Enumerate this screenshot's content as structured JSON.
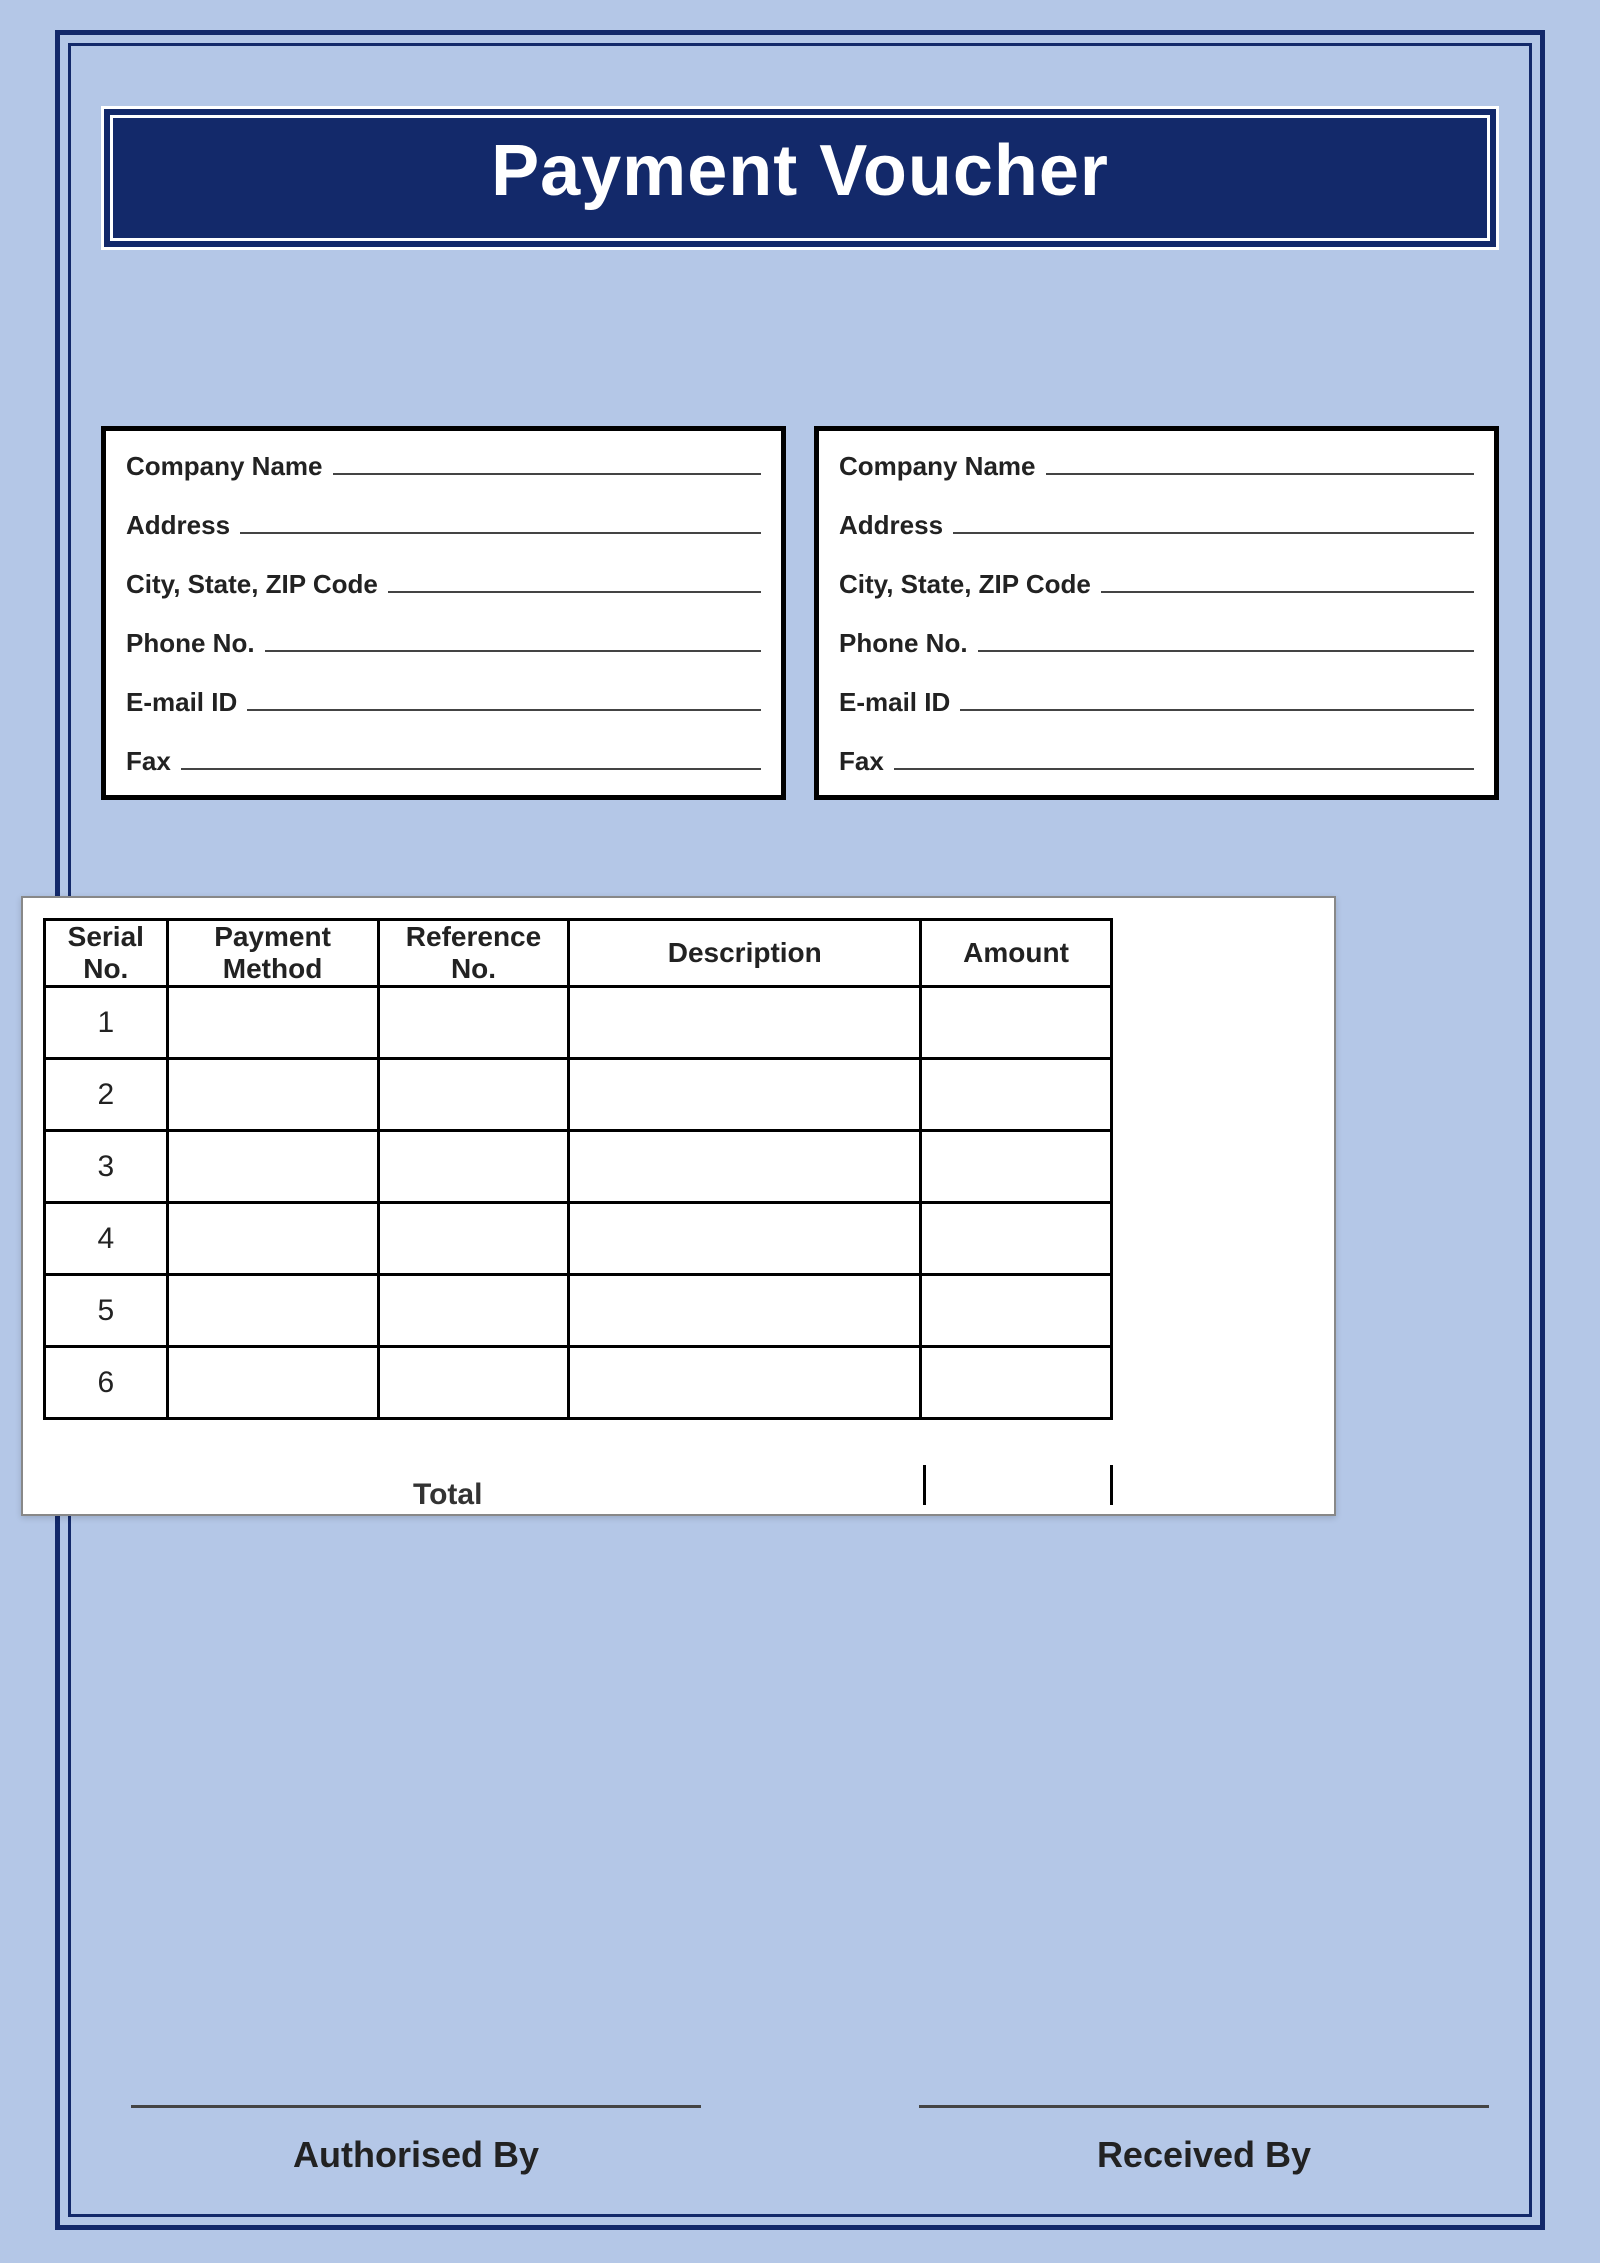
{
  "title": "Payment Voucher",
  "infoFields": {
    "company": "Company Name",
    "address": "Address",
    "csz": "City, State, ZIP Code",
    "phone": "Phone No.",
    "email": "E-mail ID",
    "fax": "Fax"
  },
  "table": {
    "headers": {
      "serial": "Serial No.",
      "method": "Payment Method",
      "ref": "Reference No.",
      "desc": "Description",
      "amt": "Amount"
    },
    "rows": [
      "1",
      "2",
      "3",
      "4",
      "5",
      "6"
    ],
    "totalLabel": "Total"
  },
  "signatures": {
    "left": "Authorised By",
    "right": "Received By"
  }
}
